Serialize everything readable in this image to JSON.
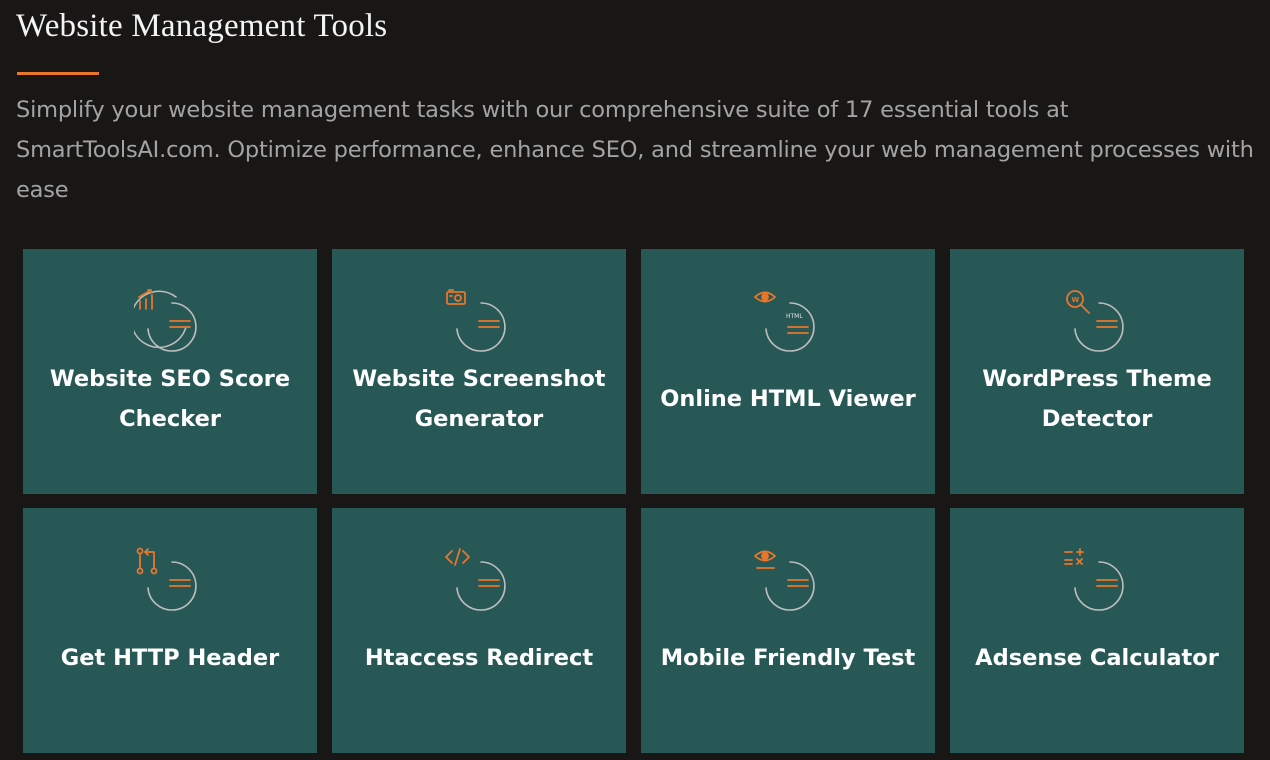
{
  "section": {
    "title": "Website Management Tools",
    "description": "Simplify your website management tasks with our comprehensive suite of 17 essential tools at SmartToolsAI.com. Optimize performance, enhance SEO, and streamline your web management processes with ease",
    "accent_color": "#e8762b",
    "card_color": "#275856"
  },
  "tools": [
    {
      "label": "Website SEO Score Checker",
      "icon": "seo-chart-icon"
    },
    {
      "label": "Website Screenshot Generator",
      "icon": "camera-icon"
    },
    {
      "label": "Online HTML Viewer",
      "icon": "eye-html-icon",
      "icon_text": "HTML"
    },
    {
      "label": "WordPress Theme Detector",
      "icon": "search-wordpress-icon"
    },
    {
      "label": "Get HTTP Header",
      "icon": "pull-request-icon"
    },
    {
      "label": "Htaccess Redirect",
      "icon": "code-icon"
    },
    {
      "label": "Mobile Friendly Test",
      "icon": "eye-icon"
    },
    {
      "label": "Adsense Calculator",
      "icon": "calculator-icon"
    }
  ]
}
